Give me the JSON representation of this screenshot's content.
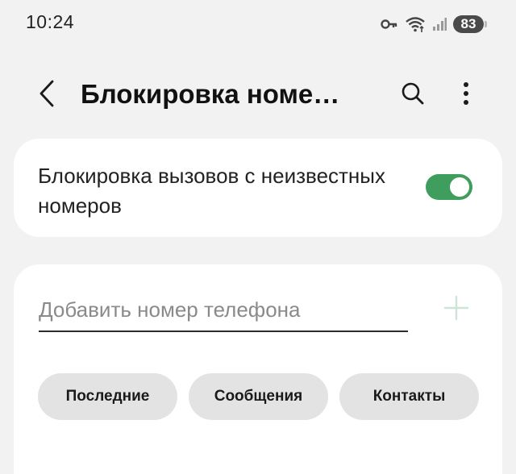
{
  "status_bar": {
    "time": "10:24",
    "battery_level": "83",
    "icons": [
      "key-icon",
      "wifi-icon",
      "signal-icon",
      "battery-icon"
    ]
  },
  "header": {
    "title": "Блокировка номе…",
    "back_icon": "chevron-left-icon",
    "search_icon": "search-icon",
    "more_icon": "more-vertical-icon"
  },
  "unknown_block": {
    "label": "Блокировка вызовов с неизвестных номеров",
    "enabled": true
  },
  "add_number": {
    "placeholder": "Добавить номер телефона",
    "value": "",
    "add_icon": "plus-icon"
  },
  "chips": {
    "recent": "Последние",
    "messages": "Сообщения",
    "contacts": "Контакты"
  },
  "colors": {
    "background": "#f2f2f2",
    "card": "#ffffff",
    "switch_on": "#3f9e5e",
    "chip_bg": "#e3e3e3",
    "plus_disabled": "#cfe3d6"
  }
}
